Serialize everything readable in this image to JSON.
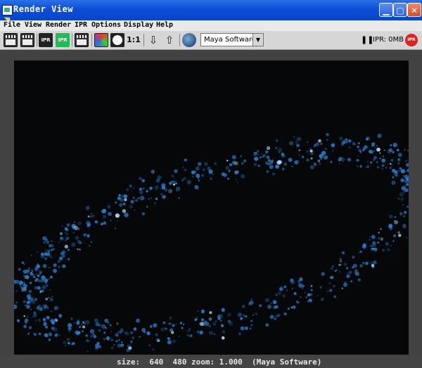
{
  "window": {
    "title": "Render View"
  },
  "menu": [
    "File",
    "View",
    "Render",
    "IPR",
    "Options",
    "Display",
    "Help"
  ],
  "toolbar": {
    "ipr_label": "IPR",
    "ratio_label": "1:1",
    "renderer": "Maya Software",
    "ipr_memory": "IPR: 0MB",
    "ipr_stop_label": "IPR"
  },
  "status": {
    "text": "size:  640  480 zoom: 1.000  (Maya Software)"
  },
  "colors": {
    "particle": "#2e7fd0",
    "background": "#050708",
    "titlebar": "#0b4fd8"
  }
}
